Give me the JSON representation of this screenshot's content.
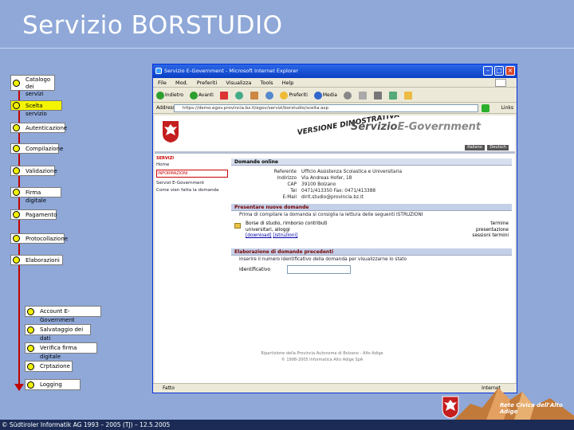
{
  "title": "Servizio BORSTUDIO",
  "steps": [
    {
      "label": "Catalogo dei servizi",
      "active": false
    },
    {
      "label": "Scelta servizio",
      "active": true
    },
    {
      "label": "Autenticazione",
      "active": false
    },
    {
      "label": "Compilazione",
      "active": false
    },
    {
      "label": "Validazione",
      "active": false
    },
    {
      "label": "Firma digitale",
      "active": false
    },
    {
      "label": "Pagamento",
      "active": false
    },
    {
      "label": "Protocollazione",
      "active": false
    },
    {
      "label": "Elaborazioni",
      "active": false
    }
  ],
  "substeps": [
    "Account E-Government",
    "Salvataggio dei dati",
    "Verifica firma digitale",
    "Crptazione",
    "Logging"
  ],
  "browser": {
    "window_title": "Servizio E-Government - Microsoft Internet Explorer",
    "menu": [
      "File",
      "Mod.",
      "Preferiti",
      "Visualizza",
      "Tools",
      "Help"
    ],
    "toolbar": [
      "Indietro",
      "Avanti",
      "Preferiti",
      "Media"
    ],
    "address_label": "Address",
    "address_value": "https://demo.egov.provincia.bz.it/egov/servizi/borstudio/scelta.asp",
    "links_label": "Links",
    "status_text": "Fatto",
    "status_zone": "Internet"
  },
  "page": {
    "stamp": "VERSIONE DIMOSTRATIVA",
    "brand_prefix": "Servizio",
    "brand_suffix": "E-Government",
    "header_buttons": [
      "Italiano",
      "Deutsch"
    ],
    "nav_section_services": "SERVIZI",
    "nav_item_home": "Home",
    "nav_section_info": "INFORMAZIONI",
    "nav_items": [
      "Servizi E-Government",
      "Come vien fatta la domanda"
    ],
    "domande_title": "Domande online",
    "office_rows": [
      {
        "label": "Referente",
        "value": "Ufficio Assistenza Scolastica e Universitaria"
      },
      {
        "label": "Indirizzo",
        "value": "Via Andreas Hofer, 18"
      },
      {
        "label": "CAP",
        "value": "39100 Bolzano"
      },
      {
        "label": "Tel",
        "value": "0471/413350  Fax: 0471/413388"
      },
      {
        "label": "E-Mail",
        "value": "dirit.studio@provincia.bz.it"
      }
    ],
    "new_section_title": "Presentare nuove domande",
    "new_section_note": "Prima di compilare la domanda si consiglia la lettura delle seguenti ISTRUZIONI",
    "deadline_label": "termine presentazione",
    "doc_title": "Borse di studio, rimborso contributi universitari, alloggi",
    "doc_download": "[download]",
    "doc_info": "[istruzioni]",
    "deadline_value": "sessioni termini",
    "prev_section_title": "Elaborazione di domande precedenti",
    "prev_note": "Inserire il numero identificativo della domanda per visualizzarne lo stato",
    "id_label": "Identificativo",
    "footer1": "Ripartizione della Provincia Autonoma di Bolzano - Alto Adige",
    "footer2": "© 1998-2005 Informatica Alto Adige SpA"
  },
  "footer_copyright": "© Südtiroler Informatik AG 1993 – 2005   (TJ) – 12.5.2005",
  "rete_civica": "Rete Civica dell'Alto Adige",
  "colors": {
    "background": "#8fa8d8",
    "accent_red": "#c00000",
    "step_highlight": "#f4f400"
  }
}
